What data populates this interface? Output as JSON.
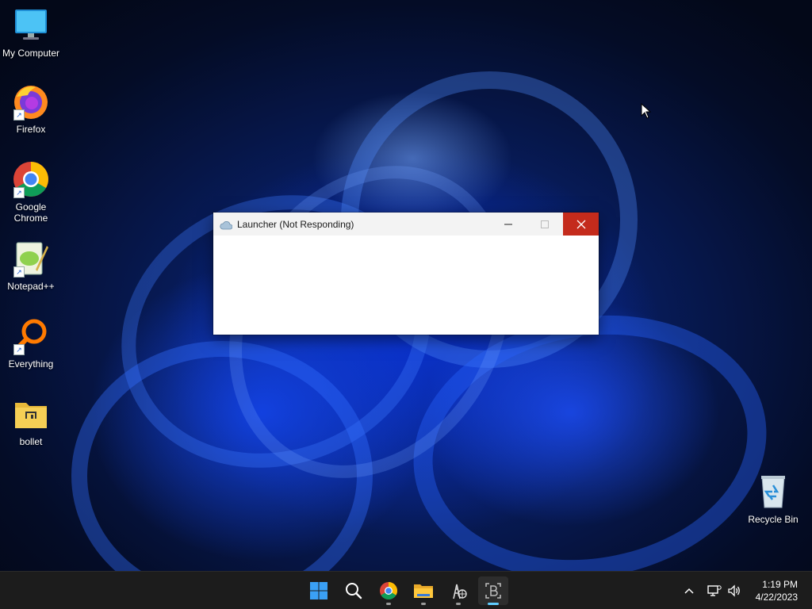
{
  "desktop": {
    "icons": [
      {
        "label": "My Computer",
        "icon": "monitor-icon"
      },
      {
        "label": "Firefox",
        "icon": "firefox-icon"
      },
      {
        "label": "Google Chrome",
        "icon": "chrome-icon"
      },
      {
        "label": "Notepad++",
        "icon": "notepadpp-icon"
      },
      {
        "label": "Everything",
        "icon": "search-magnifier-icon"
      },
      {
        "label": "bollet",
        "icon": "folder-icon"
      },
      {
        "label": "Recycle Bin",
        "icon": "recycle-bin-icon"
      }
    ]
  },
  "window": {
    "title": "Launcher (Not Responding)",
    "icon": "cloud-icon",
    "controls": {
      "minimize": "minimize-icon",
      "maximize": "maximize-icon",
      "close": "close-icon"
    },
    "close_color": "#c42b1c"
  },
  "taskbar": {
    "apps": [
      {
        "name": "start",
        "icon": "windows-logo-icon"
      },
      {
        "name": "search",
        "icon": "search-icon"
      },
      {
        "name": "chrome",
        "icon": "chrome-icon"
      },
      {
        "name": "file-explorer",
        "icon": "folder-icon"
      },
      {
        "name": "network-app",
        "icon": "globe-tower-icon"
      },
      {
        "name": "launcher",
        "icon": "app-b-icon",
        "active": true
      }
    ],
    "tray": [
      "chevron-up-icon",
      "network-icon",
      "volume-icon"
    ],
    "clock": {
      "time": "1:19 PM",
      "date": "4/22/2023"
    },
    "accent": "#60cdff"
  }
}
